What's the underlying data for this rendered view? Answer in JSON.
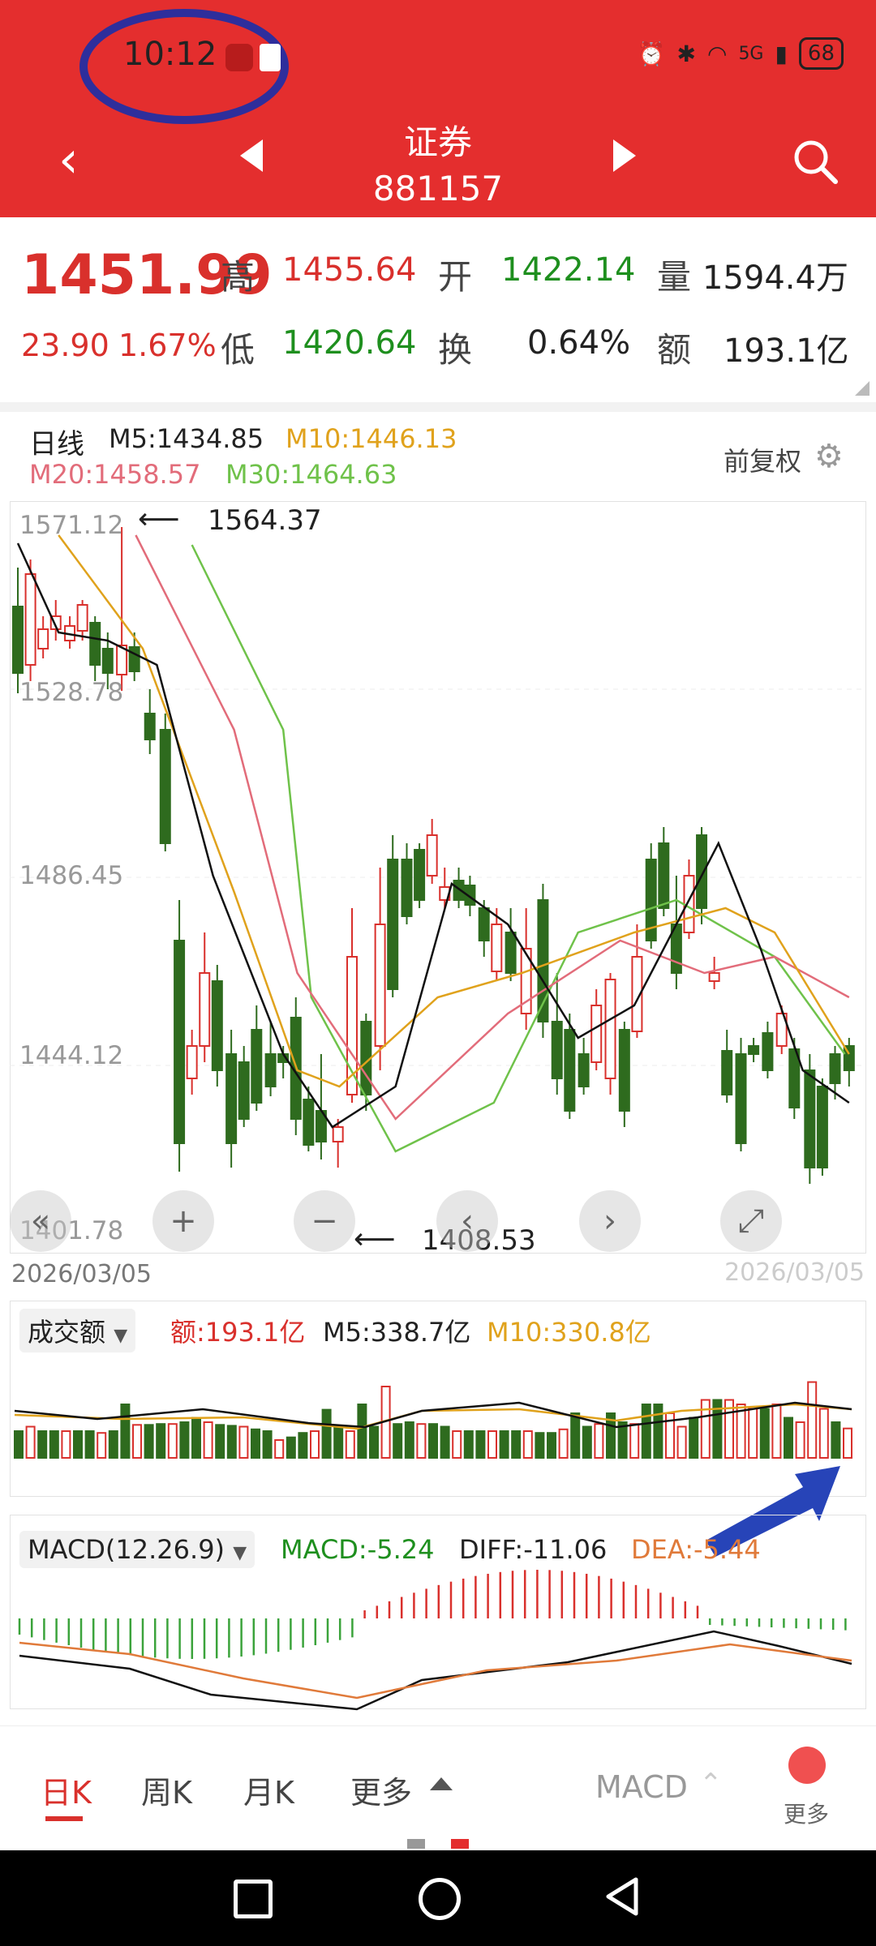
{
  "status_bar": {
    "time": "10:12",
    "battery": "68",
    "network": "5G"
  },
  "header": {
    "title": "证券",
    "code": "881157"
  },
  "quote": {
    "price": "1451.99",
    "change": "23.90",
    "change_pct": "1.67%",
    "high_label": "高",
    "high": "1455.64",
    "open_label": "开",
    "open": "1422.14",
    "volume_label": "量",
    "volume": "1594.4万",
    "low_label": "低",
    "low": "1420.64",
    "turnover_label": "换",
    "turnover": "0.64%",
    "amount_label": "额",
    "amount": "193.1亿"
  },
  "indicators": {
    "period": "日线",
    "m5": "M5:1434.85",
    "m10": "M10:1446.13",
    "m20": "M20:1458.57",
    "m30": "M30:1464.63",
    "adjust": "前复权"
  },
  "price_chart": {
    "axis_labels": [
      "1571.12",
      "1528.78",
      "1486.45",
      "1444.12",
      "1401.78"
    ],
    "high_annotation": "1564.37",
    "low_annotation": "1408.53",
    "date": "2026/03/05",
    "date_right": "2026/03/05"
  },
  "volume_panel": {
    "selector": "成交额",
    "amount": "额:193.1亿",
    "m5": "M5:338.7亿",
    "m10": "M10:330.8亿"
  },
  "macd_panel": {
    "selector": "MACD(12.26.9)",
    "macd": "MACD:-5.24",
    "diff": "DIFF:-11.06",
    "dea": "DEA:-5.44"
  },
  "bottom_tabs": {
    "day": "日K",
    "week": "周K",
    "month": "月K",
    "more": "更多",
    "indicator": "MACD",
    "more_right": "更多"
  },
  "colors": {
    "header": "#E42E2E",
    "up": "#D9302C",
    "down": "#2E6B1E",
    "m5": "#111111",
    "m10": "#E0A21C",
    "m20": "#E26C7A",
    "m30": "#6FC24A"
  },
  "chart_data": [
    {
      "type": "candlestick",
      "title": "日线",
      "ylim": [
        1401.78,
        1571.12
      ],
      "yticks": [
        1571.12,
        1528.78,
        1486.45,
        1444.12,
        1401.78
      ],
      "series": [
        {
          "name": "M5",
          "value": 1434.85
        },
        {
          "name": "M10",
          "value": 1446.13
        },
        {
          "name": "M20",
          "value": 1458.57
        },
        {
          "name": "M30",
          "value": 1464.63
        }
      ],
      "annotations": [
        "1564.37",
        "1408.53"
      ]
    },
    {
      "type": "bar",
      "title": "成交额",
      "series": [
        {
          "name": "M5",
          "value": "338.7亿"
        },
        {
          "name": "M10",
          "value": "330.8亿"
        }
      ]
    },
    {
      "type": "bar",
      "title": "MACD(12.26.9)",
      "series": [
        {
          "name": "MACD",
          "value": -5.24
        },
        {
          "name": "DIFF",
          "value": -11.06
        },
        {
          "name": "DEA",
          "value": -5.44
        }
      ]
    }
  ]
}
